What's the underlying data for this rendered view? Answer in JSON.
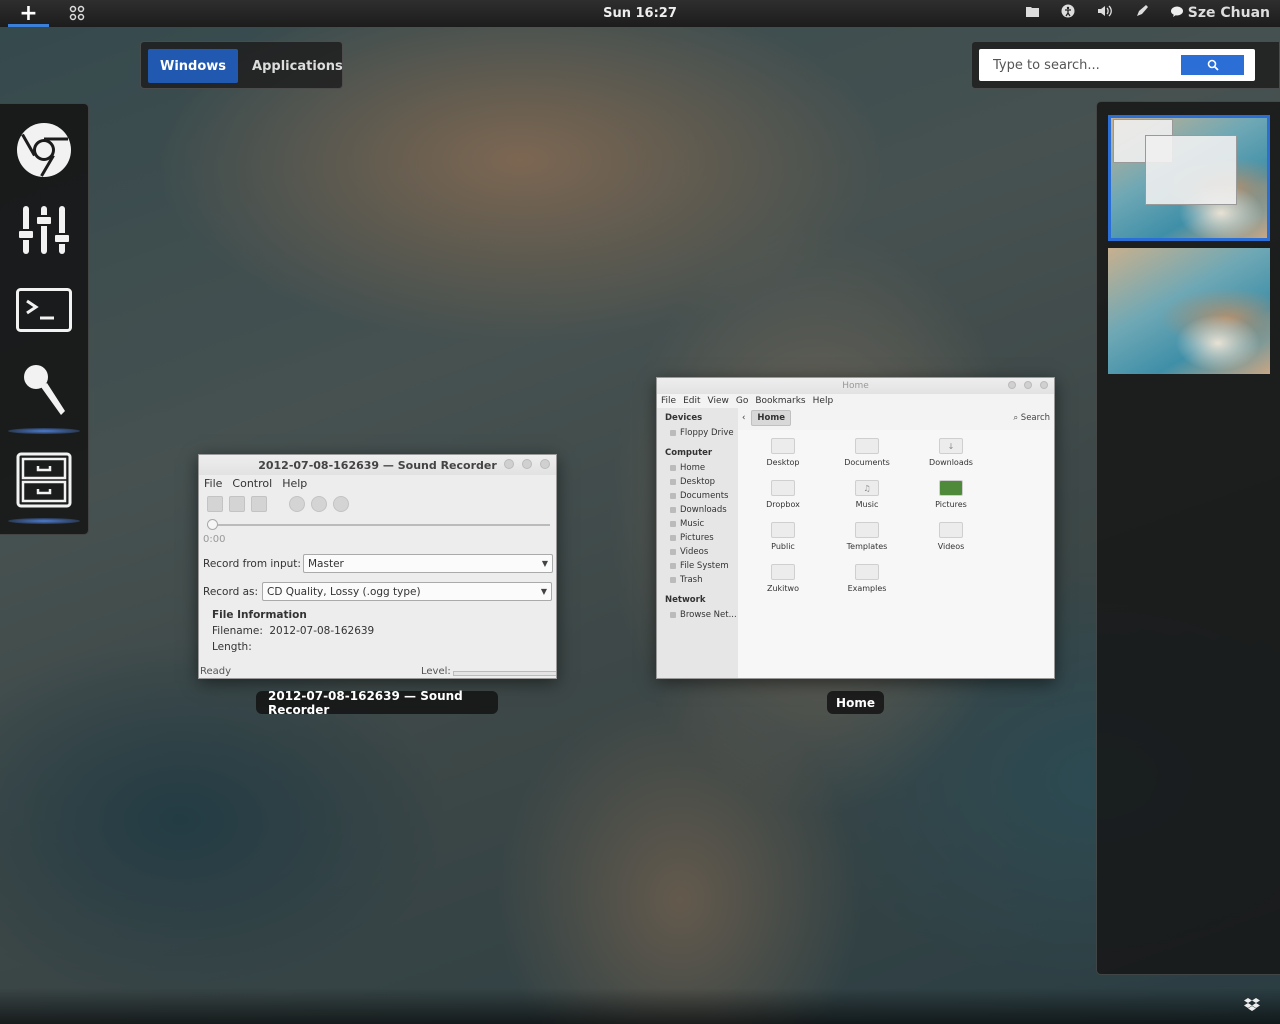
{
  "top_panel": {
    "activities_icon": "plus-icon",
    "app_menu_icon": "app-menu-icon",
    "clock": "Sun 16:27",
    "tray_icons": [
      "folder-icon",
      "accessibility-icon",
      "volume-icon",
      "pen-icon",
      "chat-icon"
    ],
    "user_name": "Sze Chuan"
  },
  "view_selector": {
    "windows_label": "Windows",
    "applications_label": "Applications",
    "active": "Windows"
  },
  "search": {
    "placeholder": "Type to search...",
    "button_icon": "search-icon"
  },
  "dash": {
    "items": [
      {
        "icon": "chrome-icon",
        "running": false
      },
      {
        "icon": "mixer-icon",
        "running": false
      },
      {
        "icon": "terminal-icon",
        "running": false
      },
      {
        "icon": "microphone-icon",
        "running": true
      },
      {
        "icon": "file-cabinet-icon",
        "running": true
      }
    ]
  },
  "sound_recorder": {
    "title": "2012-07-08-162639 — Sound Recorder",
    "menu": [
      "File",
      "Control",
      "Help"
    ],
    "time": "0:00",
    "record_from_label": "Record from input:",
    "record_from_value": "Master",
    "record_as_label": "Record as:",
    "record_as_value": "CD Quality, Lossy (.ogg type)",
    "info_heading": "File Information",
    "filename_label": "Filename:",
    "filename_value": "2012-07-08-162639",
    "length_label": "Length:",
    "status": "Ready",
    "level_label": "Level:",
    "caption": "2012-07-08-162639 — Sound Recorder"
  },
  "file_manager": {
    "title": "Home",
    "menu": [
      "File",
      "Edit",
      "View",
      "Go",
      "Bookmarks",
      "Help"
    ],
    "devices_heading": "Devices",
    "devices": [
      "Floppy Drive"
    ],
    "computer_heading": "Computer",
    "computer_items": [
      "Home",
      "Desktop",
      "Documents",
      "Downloads",
      "Music",
      "Pictures",
      "Videos",
      "File System",
      "Trash"
    ],
    "network_heading": "Network",
    "network_items": [
      "Browse Net..."
    ],
    "breadcrumb": "Home",
    "search_label": "Search",
    "items": [
      "Desktop",
      "Documents",
      "Downloads",
      "Dropbox",
      "Music",
      "Pictures",
      "Public",
      "Templates",
      "Videos",
      "Zukitwo",
      "Examples"
    ],
    "caption": "Home"
  },
  "workspaces": {
    "count": 2,
    "active_index": 0
  },
  "bottom_tray": {
    "icon": "dropbox-icon"
  },
  "colors": {
    "accent": "#2259b0",
    "search_button": "#2a6ed6",
    "panel": "#1c1c1c"
  }
}
